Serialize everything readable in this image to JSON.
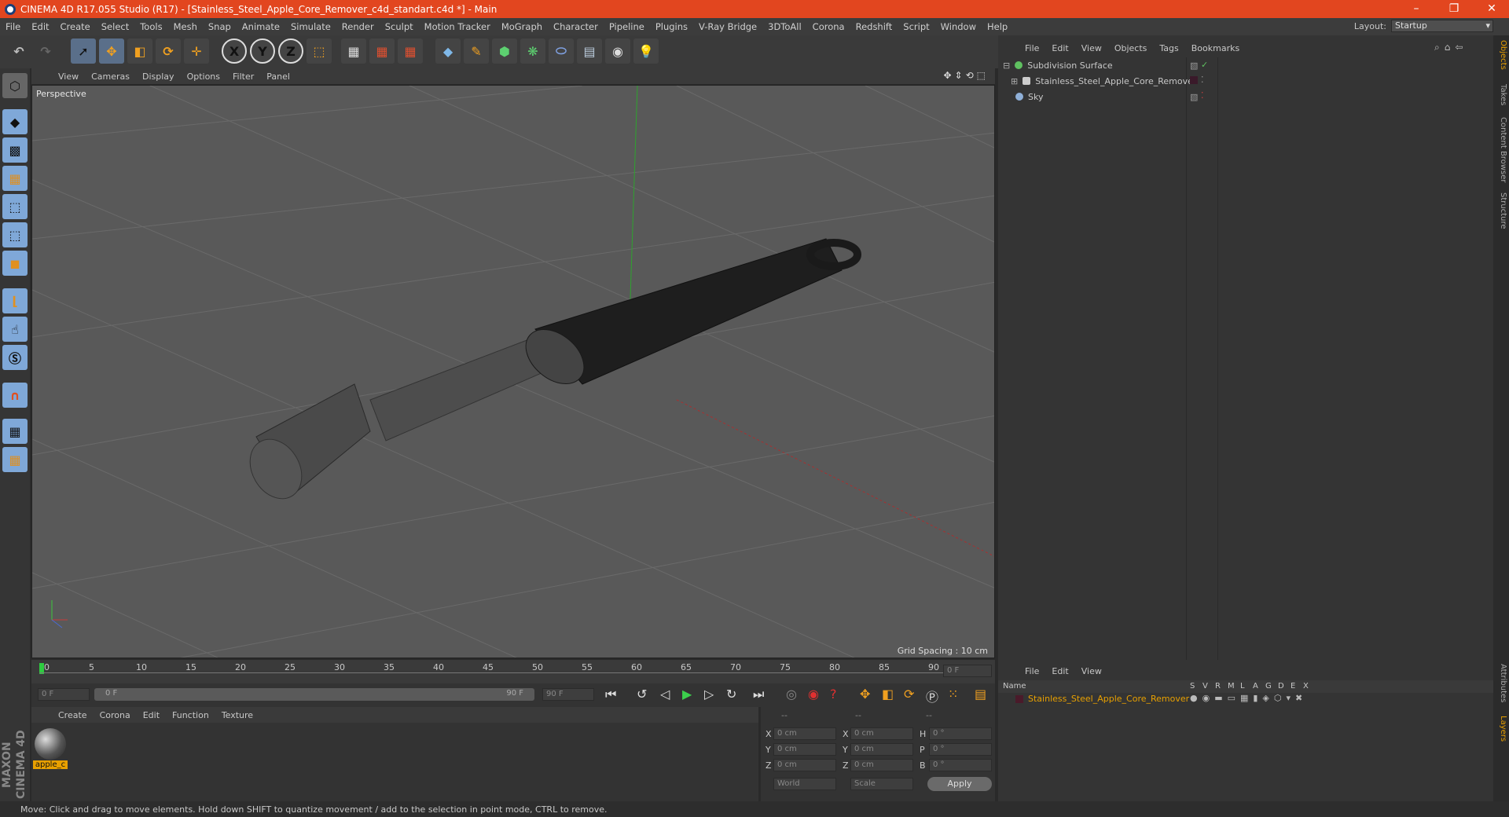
{
  "window": {
    "title": "CINEMA 4D R17.055 Studio (R17) - [Stainless_Steel_Apple_Core_Remover_c4d_standart.c4d *] - Main",
    "minimize": "–",
    "restore": "❐",
    "close": "✕"
  },
  "menubar": {
    "items": [
      "File",
      "Edit",
      "Create",
      "Select",
      "Tools",
      "Mesh",
      "Snap",
      "Animate",
      "Simulate",
      "Render",
      "Sculpt",
      "Motion Tracker",
      "MoGraph",
      "Character",
      "Pipeline",
      "Plugins",
      "V-Ray Bridge",
      "3DToAll",
      "Corona",
      "Redshift",
      "Script",
      "Window",
      "Help"
    ],
    "layout_label": "Layout:",
    "layout_value": "Startup"
  },
  "toolbar": {
    "axis_x": "X",
    "axis_y": "Y",
    "axis_z": "Z"
  },
  "viewport": {
    "menu": [
      "View",
      "Cameras",
      "Display",
      "Options",
      "Filter",
      "Panel"
    ],
    "label": "Perspective",
    "grid_spacing": "Grid Spacing : 10 cm"
  },
  "timeline": {
    "ticks": [
      "0",
      "5",
      "10",
      "15",
      "20",
      "25",
      "30",
      "35",
      "40",
      "45",
      "50",
      "55",
      "60",
      "65",
      "70",
      "75",
      "80",
      "85",
      "90"
    ],
    "current_frame": "0 F",
    "start_field": "0 F",
    "range_start": "0 F",
    "range_end": "90 F",
    "end_field": "90 F"
  },
  "materials": {
    "menu": [
      "Create",
      "Corona",
      "Edit",
      "Function",
      "Texture"
    ],
    "items": [
      {
        "name": "apple_c"
      }
    ]
  },
  "coords": {
    "header": [
      "--",
      "--",
      "--"
    ],
    "rows": [
      {
        "a": "X",
        "v1": "0 cm",
        "b": "X",
        "v2": "0 cm",
        "c": "H",
        "v3": "0 °"
      },
      {
        "a": "Y",
        "v1": "0 cm",
        "b": "Y",
        "v2": "0 cm",
        "c": "P",
        "v3": "0 °"
      },
      {
        "a": "Z",
        "v1": "0 cm",
        "b": "Z",
        "v2": "0 cm",
        "c": "B",
        "v3": "0 °"
      }
    ],
    "space": "World",
    "mode": "Scale",
    "apply": "Apply"
  },
  "objects": {
    "menu": [
      "File",
      "Edit",
      "View",
      "Objects",
      "Tags",
      "Bookmarks"
    ],
    "tree": [
      {
        "name": "Subdivision Surface",
        "color": "#6fd06f"
      },
      {
        "name": "Stainless_Steel_Apple_Core_Remover",
        "color": "#d0d0d0"
      },
      {
        "name": "Sky",
        "color": "#9ab4d0"
      }
    ]
  },
  "layers": {
    "menu": [
      "File",
      "Edit",
      "View"
    ],
    "columns": [
      "Name",
      "S",
      "V",
      "R",
      "M",
      "L",
      "A",
      "G",
      "D",
      "E",
      "X"
    ],
    "rows": [
      {
        "name": "Stainless_Steel_Apple_Core_Remover",
        "color": "#e8a000"
      }
    ]
  },
  "side_tabs": [
    "Objects",
    "Takes",
    "Content Browser",
    "Structure",
    "Attributes",
    "Layers"
  ],
  "brand": "MAXON CINEMA 4D",
  "status": "Move: Click and drag to move elements. Hold down SHIFT to quantize movement / add to the selection in point mode, CTRL to remove."
}
